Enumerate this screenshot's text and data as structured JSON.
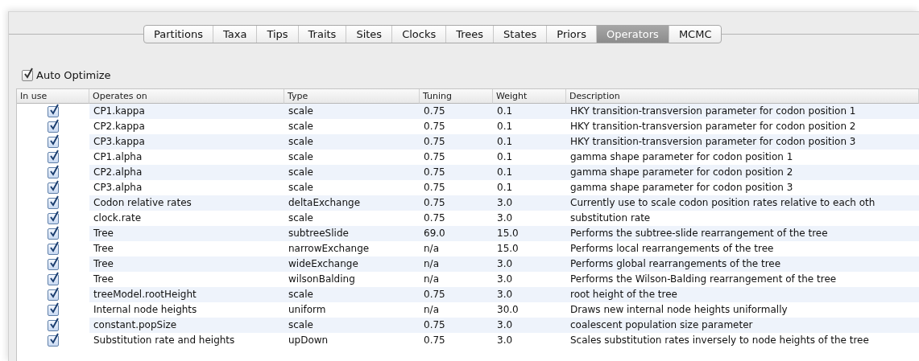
{
  "tabs": [
    {
      "label": "Partitions",
      "selected": false
    },
    {
      "label": "Taxa",
      "selected": false
    },
    {
      "label": "Tips",
      "selected": false
    },
    {
      "label": "Traits",
      "selected": false
    },
    {
      "label": "Sites",
      "selected": false
    },
    {
      "label": "Clocks",
      "selected": false
    },
    {
      "label": "Trees",
      "selected": false
    },
    {
      "label": "States",
      "selected": false
    },
    {
      "label": "Priors",
      "selected": false
    },
    {
      "label": "Operators",
      "selected": true
    },
    {
      "label": "MCMC",
      "selected": false
    }
  ],
  "auto_optimize": {
    "label": "Auto Optimize",
    "checked": true
  },
  "table": {
    "columns": [
      "In use",
      "Operates on",
      "Type",
      "Tuning",
      "Weight",
      "Description"
    ],
    "rows": [
      {
        "in_use": true,
        "operates_on": "CP1.kappa",
        "type": "scale",
        "tuning": "0.75",
        "weight": "0.1",
        "description": "HKY transition-transversion parameter for codon position 1"
      },
      {
        "in_use": true,
        "operates_on": "CP2.kappa",
        "type": "scale",
        "tuning": "0.75",
        "weight": "0.1",
        "description": "HKY transition-transversion parameter for codon position 2"
      },
      {
        "in_use": true,
        "operates_on": "CP3.kappa",
        "type": "scale",
        "tuning": "0.75",
        "weight": "0.1",
        "description": "HKY transition-transversion parameter for codon position 3"
      },
      {
        "in_use": true,
        "operates_on": "CP1.alpha",
        "type": "scale",
        "tuning": "0.75",
        "weight": "0.1",
        "description": "gamma shape parameter for codon position 1"
      },
      {
        "in_use": true,
        "operates_on": "CP2.alpha",
        "type": "scale",
        "tuning": "0.75",
        "weight": "0.1",
        "description": "gamma shape parameter for codon position 2"
      },
      {
        "in_use": true,
        "operates_on": "CP3.alpha",
        "type": "scale",
        "tuning": "0.75",
        "weight": "0.1",
        "description": "gamma shape parameter for codon position 3"
      },
      {
        "in_use": true,
        "operates_on": "Codon relative rates",
        "type": "deltaExchange",
        "tuning": "0.75",
        "weight": "3.0",
        "description": "Currently use to scale codon position rates relative to each oth"
      },
      {
        "in_use": true,
        "operates_on": "clock.rate",
        "type": "scale",
        "tuning": "0.75",
        "weight": "3.0",
        "description": "substitution rate"
      },
      {
        "in_use": true,
        "operates_on": "Tree",
        "type": "subtreeSlide",
        "tuning": "69.0",
        "weight": "15.0",
        "description": "Performs the subtree-slide rearrangement of the tree"
      },
      {
        "in_use": true,
        "operates_on": "Tree",
        "type": "narrowExchange",
        "tuning": "n/a",
        "weight": "15.0",
        "description": "Performs local rearrangements of the tree"
      },
      {
        "in_use": true,
        "operates_on": "Tree",
        "type": "wideExchange",
        "tuning": "n/a",
        "weight": "3.0",
        "description": "Performs global rearrangements of the tree"
      },
      {
        "in_use": true,
        "operates_on": "Tree",
        "type": "wilsonBalding",
        "tuning": "n/a",
        "weight": "3.0",
        "description": "Performs the Wilson-Balding rearrangement of the tree"
      },
      {
        "in_use": true,
        "operates_on": "treeModel.rootHeight",
        "type": "scale",
        "tuning": "0.75",
        "weight": "3.0",
        "description": "root height of the tree"
      },
      {
        "in_use": true,
        "operates_on": "Internal node heights",
        "type": "uniform",
        "tuning": "n/a",
        "weight": "30.0",
        "description": "Draws new internal node heights uniformally"
      },
      {
        "in_use": true,
        "operates_on": "constant.popSize",
        "type": "scale",
        "tuning": "0.75",
        "weight": "3.0",
        "description": "coalescent population size parameter"
      },
      {
        "in_use": true,
        "operates_on": "Substitution rate and heights",
        "type": "upDown",
        "tuning": "0.75",
        "weight": "3.0",
        "description": "Scales substitution rates inversely to node heights of the tree"
      }
    ]
  }
}
